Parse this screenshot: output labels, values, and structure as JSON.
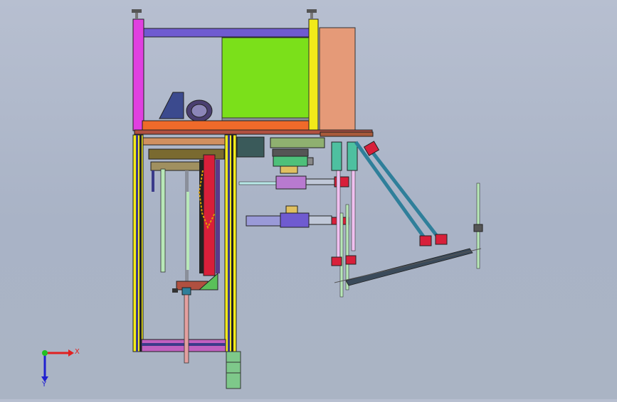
{
  "viewport": {
    "triad": {
      "x_label": "X",
      "y_label": "Y"
    }
  },
  "colors": {
    "background_top": "#b7bfd0",
    "background_bottom": "#aab4c4",
    "frame_magenta": "#e040e0",
    "frame_yellow": "#f2ea1a",
    "beam_purple": "#6f5bd0",
    "panel_green": "#7be01a",
    "panel_salmon": "#e59a78",
    "plate_orange": "#ef6a2a",
    "rod_teal": "#2f7f9a",
    "cylinder_red": "#d81f3a",
    "axis_x": "#e02020",
    "axis_y": "#2020d0",
    "axis_origin": "#22c022"
  },
  "icons": [
    "axis-triad-icon"
  ]
}
